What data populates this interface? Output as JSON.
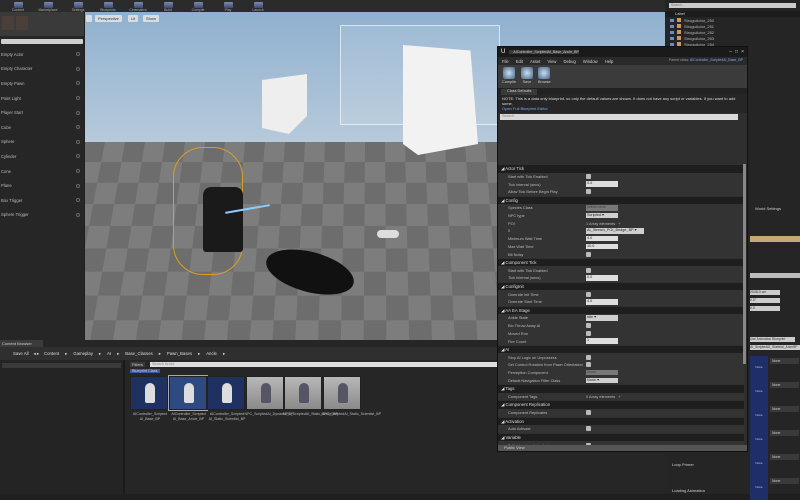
{
  "toolbar": {
    "buttons": [
      "Content",
      "Marketplace",
      "Settings",
      "Blueprints",
      "Cinematics",
      "Build",
      "Compile",
      "Play",
      "Launch"
    ]
  },
  "place_panel": {
    "items": [
      "Empty Actor",
      "Empty Character",
      "Empty Pawn",
      "Point Light",
      "Player Start",
      "Cube",
      "Sphere",
      "Cylinder",
      "Cone",
      "Plane",
      "Box Trigger",
      "Sphere Trigger"
    ]
  },
  "viewport": {
    "perspective": "Perspective",
    "lit": "Lit",
    "show": "Show"
  },
  "content_browser": {
    "tab": "Content Browser",
    "save_all": "Save All",
    "breadcrumb": [
      "Content",
      "Gameplay",
      "AI",
      "Base_Classes",
      "Pawn_Bases",
      "Ancle"
    ],
    "filters": "Filters",
    "search_placeholder": "Search Ancle",
    "folder_chip": "Blueprint Class",
    "assets": [
      {
        "name": "AIController_Scripted AI_Base_BP",
        "kind": "bp"
      },
      {
        "name": "AIController_Scripted AI_Base_Ancle_BP",
        "kind": "bp"
      },
      {
        "name": "AIController_Scripted AI_Static_Scientist_BP",
        "kind": "bp"
      },
      {
        "name": "NPC_ScriptedAI_Dynamic_BP",
        "kind": "mesh"
      },
      {
        "name": "NPC_ScriptedAI_Static_Ancle_BP",
        "kind": "mesh"
      },
      {
        "name": "NPC_ScriptedAI_Static_Scientist_BP",
        "kind": "mesh"
      }
    ]
  },
  "outliner": {
    "search_placeholder": "Search...",
    "column": "Label",
    "items": [
      "StrogoActor_250",
      "StrogoActor_251",
      "StrogoActor_252",
      "StrogoActor_253",
      "StrogoActor_254"
    ]
  },
  "right_details": {
    "world_settings": "World Settings",
    "fields": [
      "2048.0 cm",
      "0.0°",
      "0.0"
    ],
    "anim_mode": "Use Animation Blueprint",
    "anim_class": "AI_ScriptedAI_Skeletal_AnimBP",
    "thumb_none": "None",
    "loop_primer": "Loop Primer",
    "loading_animation": "Loading Animation"
  },
  "blueprint": {
    "tab_title": "AIController_ScriptedAI_Base_Ancle_BP",
    "menu": [
      "File",
      "Edit",
      "Asset",
      "View",
      "Debug",
      "Window",
      "Help"
    ],
    "parent_class_label": "Parent class:",
    "parent_class": "AIController_ScriptedAI_Base_BP",
    "tools": [
      "Compile",
      "Save",
      "Browse"
    ],
    "details_tab": "Class Defaults",
    "note": "NOTE: This is a data only blueprint, so only the default values are shown.  It does not have any script or variables.  If you want to add some,",
    "note_link": "Open Full Blueprint Editor",
    "search_placeholder": "Search",
    "sections": [
      {
        "title": "Actor Tick",
        "rows": [
          {
            "k": "Start with Tick Enabled",
            "t": "cb"
          },
          {
            "k": "Tick Interval (secs)",
            "t": "fld",
            "v": "0.0"
          },
          {
            "k": "Allow Tick Before Begin Play",
            "t": "cb"
          }
        ]
      },
      {
        "title": "Config",
        "rows": [
          {
            "k": "Species Class",
            "t": "dis",
            "v": "Wilderness Species"
          },
          {
            "k": "NPC type",
            "t": "dd",
            "v": "Scripted"
          },
          {
            "k": "POI",
            "t": "txt",
            "v": "1 Array elements"
          },
          {
            "k": "0",
            "t": "dd",
            "v": "AI_Stretch_POI_Bridge_BP"
          },
          {
            "k": "Minimum Wait Time",
            "t": "fld",
            "v": "4.0"
          },
          {
            "k": "Max Wait Time",
            "t": "fld",
            "v": "10.0"
          },
          {
            "k": "Bit Noisy",
            "t": "cb"
          }
        ]
      },
      {
        "title": "Component Tick",
        "rows": [
          {
            "k": "Start with Tick Enabled",
            "t": "cb"
          },
          {
            "k": "Tick Interval (secs)",
            "t": "fld",
            "v": "0.0"
          }
        ]
      },
      {
        "title": "ConfigInit",
        "rows": [
          {
            "k": "Override Init Time",
            "t": "cb"
          },
          {
            "k": "Override Start Time",
            "t": "fld",
            "v": "4.0"
          }
        ]
      },
      {
        "title": "AA EA Stage",
        "rows": [
          {
            "k": "Ankle State",
            "t": "dd",
            "v": "Idle"
          },
          {
            "k": "Bio Throw Away AI",
            "t": "cb"
          },
          {
            "k": "Moved Run",
            "t": "cb"
          },
          {
            "k": "Fire Count",
            "t": "fld",
            "v": "1"
          }
        ]
      },
      {
        "title": "AI",
        "rows": [
          {
            "k": "Stop AI Logic on Unpossess",
            "t": "cb"
          },
          {
            "k": "Set Control Rotation from Pawn Orientation",
            "t": "cb"
          },
          {
            "k": "Perception Component",
            "t": "dis",
            "v": "None"
          },
          {
            "k": "Default Navigation Filter Class",
            "t": "dd",
            "v": "None"
          }
        ]
      },
      {
        "title": "Tags",
        "rows": [
          {
            "k": "Component Tags",
            "t": "txt",
            "v": "0 Array elements"
          }
        ]
      },
      {
        "title": "Component Replication",
        "rows": [
          {
            "k": "Component Replicates",
            "t": "cb"
          }
        ]
      },
      {
        "title": "Activation",
        "rows": [
          {
            "k": "Auto Activate",
            "t": "cb"
          }
        ]
      },
      {
        "title": "Variable",
        "rows": [
          {
            "k": "Editable when Inherited",
            "t": "cb"
          }
        ]
      },
      {
        "title": "Cooking",
        "rows": []
      }
    ],
    "footer": "Public View"
  }
}
